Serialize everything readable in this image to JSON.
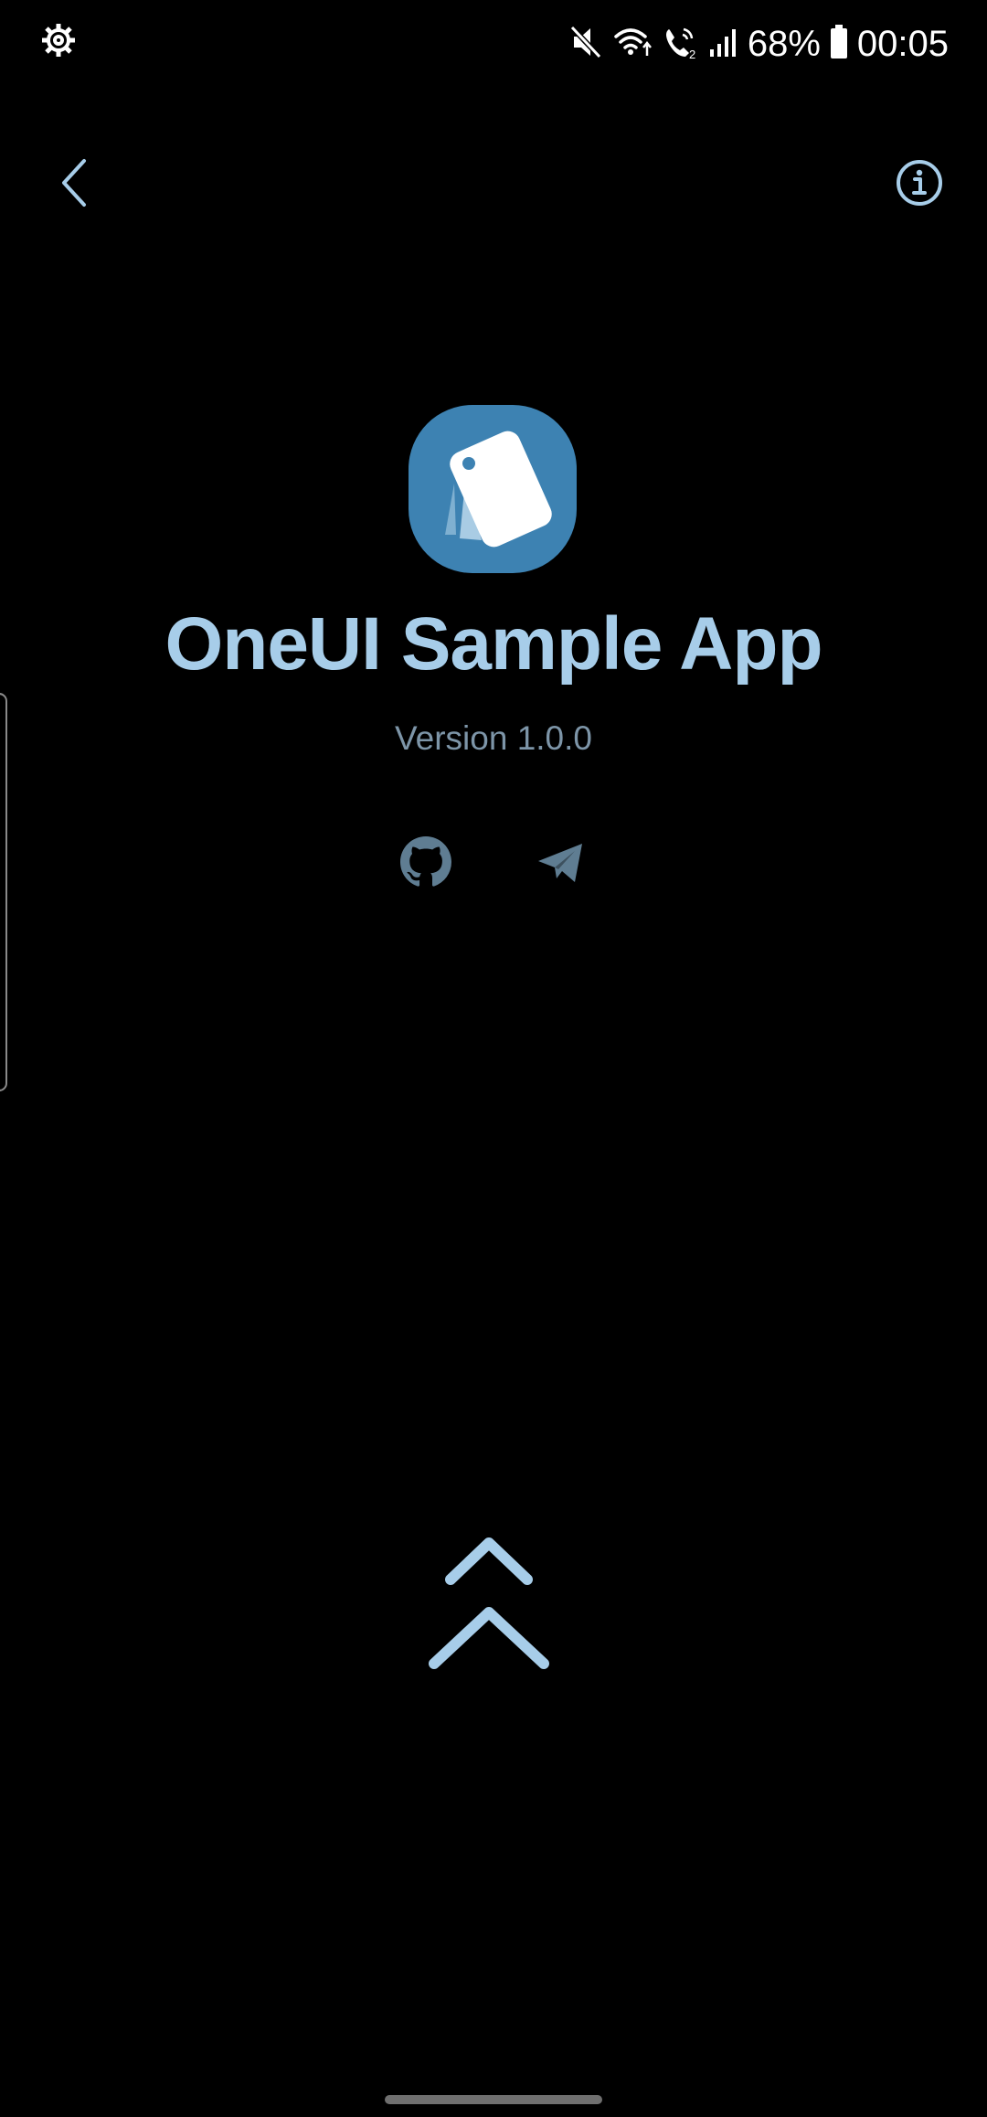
{
  "status_bar": {
    "battery_percent": "68%",
    "time": "00:05",
    "icons": [
      "settings-gear-icon",
      "mute-icon",
      "wifi-icon",
      "wifi-calling-icon",
      "signal-icon",
      "battery-icon"
    ]
  },
  "toolbar": {
    "back_icon": "chevron-left-icon",
    "info_icon": "info-icon"
  },
  "app": {
    "title": "OneUI Sample App",
    "version": "Version 1.0.0",
    "icon": "app-logo-icon"
  },
  "links": [
    {
      "icon": "github-icon"
    },
    {
      "icon": "telegram-icon"
    }
  ],
  "swipe_hint_icon": "double-chevron-up-icon",
  "colors": {
    "background": "#000000",
    "accent": "#a7cde9",
    "version_text": "#7d95a8",
    "app_icon_bg": "#3d82b2",
    "link_icons": "#5f7d92"
  }
}
